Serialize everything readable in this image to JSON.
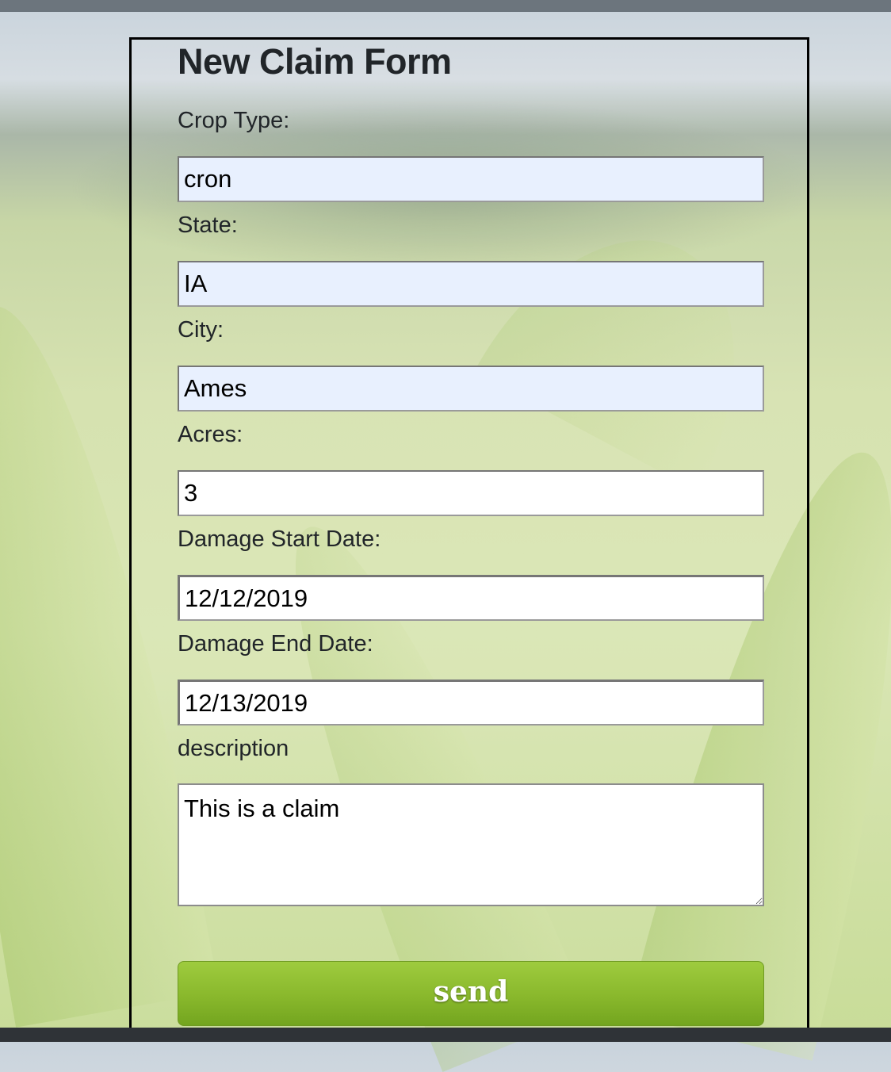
{
  "form": {
    "title": "New Claim Form",
    "crop_type": {
      "label": "Crop Type:",
      "value": "cron"
    },
    "state": {
      "label": "State:",
      "value": "IA"
    },
    "city": {
      "label": "City:",
      "value": "Ames"
    },
    "acres": {
      "label": "Acres:",
      "value": "3"
    },
    "damage_start": {
      "label": "Damage Start Date:",
      "value": "12/12/2019"
    },
    "damage_end": {
      "label": "Damage End Date:",
      "value": "12/13/2019"
    },
    "description": {
      "label": "description",
      "value": "This is a claim"
    },
    "submit_label": "send"
  },
  "colors": {
    "top_bar": "#6c757d",
    "bottom_bar": "#2f3337",
    "autofill_background": "#e8f0fe",
    "button_green": "#8cbb2e"
  }
}
